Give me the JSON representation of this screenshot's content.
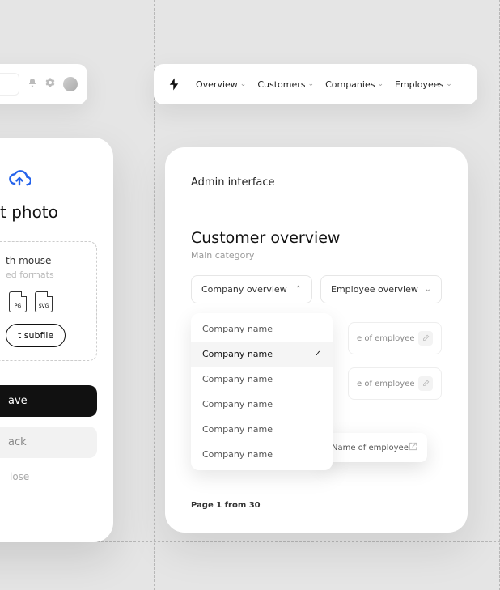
{
  "topnav": {
    "items": [
      "Overview",
      "Customers",
      "Companies",
      "Employees"
    ]
  },
  "leftHeader": {
    "bell": "bell",
    "gear": "gear"
  },
  "upload": {
    "title": "t photo",
    "dropLine1": "th mouse",
    "dropLine2": "ed formats",
    "fileTypes": [
      "PG",
      "SVG"
    ],
    "subfileBtn": "t subfile",
    "save": "ave",
    "back": "ack",
    "close": "lose"
  },
  "admin": {
    "header": "Admin interface",
    "sectionTitle": "Customer overview",
    "sectionSub": "Main category",
    "select1": "Company overview",
    "select2": "Employee overview",
    "dropdownItems": [
      {
        "label": "Company name",
        "selected": false
      },
      {
        "label": "Company name",
        "selected": true
      },
      {
        "label": "Company name",
        "selected": false
      },
      {
        "label": "Company name",
        "selected": false
      },
      {
        "label": "Company name",
        "selected": false
      },
      {
        "label": "Company name",
        "selected": false
      }
    ],
    "employeeItems": [
      "e of employee",
      "e of employee"
    ],
    "employeePopup": "Name of employee",
    "pagination": "Page 1 from 30"
  }
}
